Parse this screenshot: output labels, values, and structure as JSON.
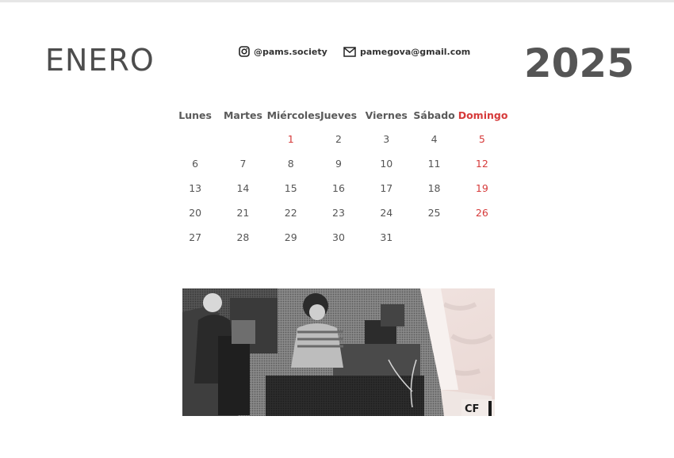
{
  "header": {
    "month": "ENERO",
    "year": "2025",
    "instagram": "@pams.society",
    "email": "pamegova@gmail.com"
  },
  "calendar": {
    "weekdays": [
      "Lunes",
      "Martes",
      "Miércoles",
      "Jueves",
      "Viernes",
      "Sábado",
      "Domingo"
    ],
    "weeks": [
      [
        "",
        "",
        "1",
        "2",
        "3",
        "4",
        "5"
      ],
      [
        "6",
        "7",
        "8",
        "9",
        "10",
        "11",
        "12"
      ],
      [
        "13",
        "14",
        "15",
        "16",
        "17",
        "18",
        "19"
      ],
      [
        "20",
        "21",
        "22",
        "23",
        "24",
        "25",
        "26"
      ],
      [
        "27",
        "28",
        "29",
        "30",
        "31",
        "",
        ""
      ]
    ],
    "holidays": [
      "1"
    ]
  },
  "photo": {
    "caption_fragment": "CF"
  },
  "colors": {
    "text": "#555555",
    "sunday": "#d63a3a",
    "contact": "#333333"
  },
  "icons": {
    "instagram": "instagram-icon",
    "email": "mail-icon"
  }
}
